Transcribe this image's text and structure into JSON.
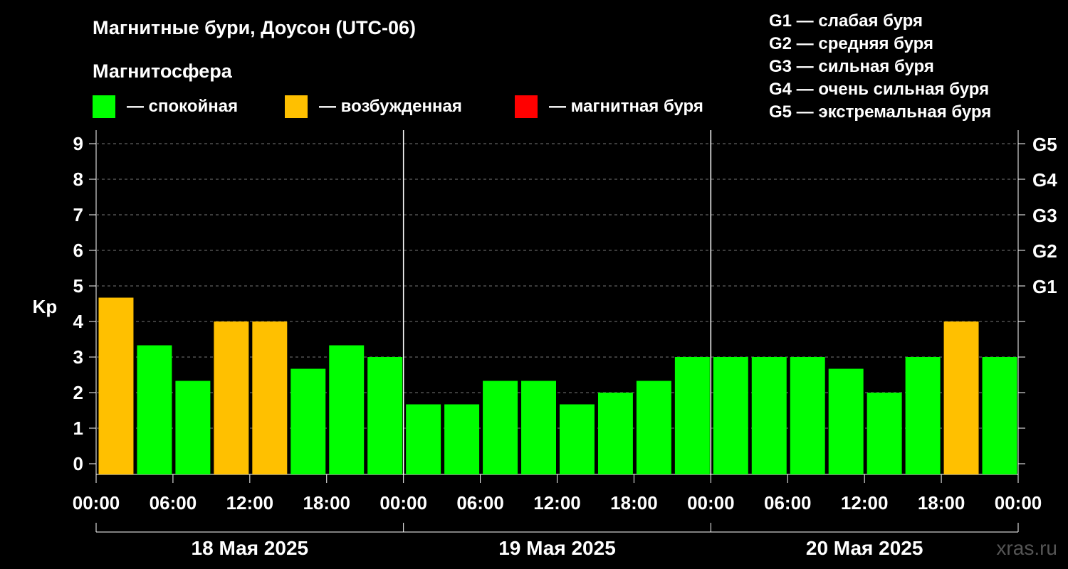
{
  "chart_data": {
    "type": "bar",
    "title": "Магнитные бури, Доусон (UTC-06)",
    "subtitle": "Магнитосфера",
    "ylabel": "Kp",
    "ylim": [
      0,
      9
    ],
    "yticks": [
      "0",
      "1",
      "2",
      "3",
      "4",
      "5",
      "6",
      "7",
      "8",
      "9"
    ],
    "grid": "dashed horizontal",
    "legend": [
      {
        "label": "— спокойная",
        "color": "#00ff00"
      },
      {
        "label": "— возбужденная",
        "color": "#ffc000"
      },
      {
        "label": "— магнитная буря",
        "color": "#ff0000"
      }
    ],
    "g_scale_legend": [
      "G1 — слабая буря",
      "G2 — средняя буря",
      "G3 — сильная буря",
      "G4 — очень сильная буря",
      "G5 — экстремальная буря"
    ],
    "g_axis": [
      {
        "label": "G1",
        "kp": 5
      },
      {
        "label": "G2",
        "kp": 6
      },
      {
        "label": "G3",
        "kp": 7
      },
      {
        "label": "G4",
        "kp": 8
      },
      {
        "label": "G5",
        "kp": 9
      }
    ],
    "xtick_labels": [
      "00:00",
      "06:00",
      "12:00",
      "18:00",
      "00:00",
      "06:00",
      "12:00",
      "18:00",
      "00:00",
      "06:00",
      "12:00",
      "18:00",
      "00:00"
    ],
    "days": [
      "18 Мая 2025",
      "19 Мая 2025",
      "20 Мая 2025"
    ],
    "series": [
      {
        "values": [
          4.67,
          3.33,
          2.33,
          4.0,
          4.0,
          2.67,
          3.33,
          3.0,
          1.67,
          1.67,
          2.33,
          2.33,
          1.67,
          2.0,
          2.33,
          3.0,
          3.0,
          3.0,
          3.0,
          2.67,
          2.0,
          3.0,
          4.0,
          3.0
        ],
        "colors": [
          "#ffc000",
          "#00ff00",
          "#00ff00",
          "#ffc000",
          "#ffc000",
          "#00ff00",
          "#00ff00",
          "#00ff00",
          "#00ff00",
          "#00ff00",
          "#00ff00",
          "#00ff00",
          "#00ff00",
          "#00ff00",
          "#00ff00",
          "#00ff00",
          "#00ff00",
          "#00ff00",
          "#00ff00",
          "#00ff00",
          "#00ff00",
          "#00ff00",
          "#ffc000",
          "#00ff00"
        ]
      }
    ]
  },
  "watermark": "xras.ru"
}
